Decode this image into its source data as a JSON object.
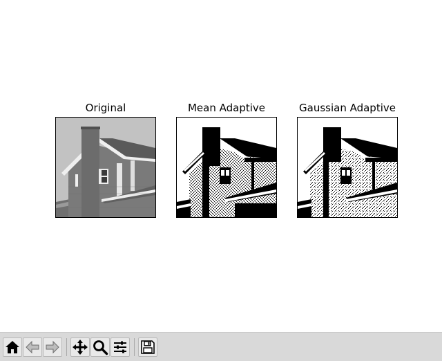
{
  "figure": {
    "panels": [
      {
        "title": "Original",
        "render": "gray"
      },
      {
        "title": "Mean Adaptive",
        "render": "mean"
      },
      {
        "title": "Gaussian Adaptive",
        "render": "gauss"
      }
    ]
  },
  "toolbar": {
    "buttons": [
      {
        "icon": "home-icon",
        "action": "home"
      },
      {
        "icon": "back-arrow-icon",
        "action": "back"
      },
      {
        "icon": "forward-arrow-icon",
        "action": "forward"
      },
      {
        "icon": "pan-arrows-icon",
        "action": "pan"
      },
      {
        "icon": "zoom-magnifier-icon",
        "action": "zoom"
      },
      {
        "icon": "subplots-sliders-icon",
        "action": "configure-subplots"
      },
      {
        "icon": "save-floppy-icon",
        "action": "save"
      }
    ]
  },
  "colors": {
    "toolbar_bg": "#d9d9d9",
    "button_bg": "#e9e9e9",
    "sky_gray": "#c2c2c2",
    "wall_gray": "#767676",
    "roof_gray": "#585858",
    "trim_white": "#f2f2f2"
  }
}
